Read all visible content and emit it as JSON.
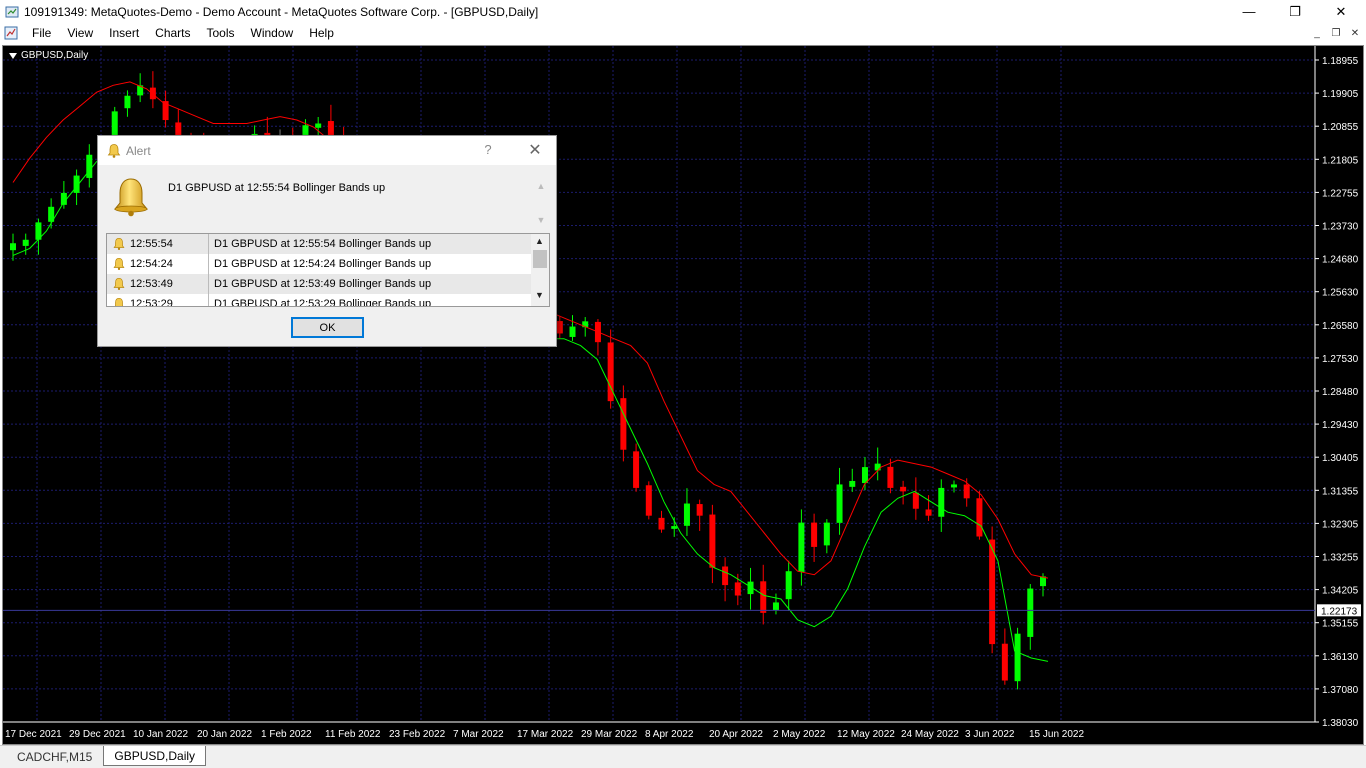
{
  "window": {
    "title": "109191349: MetaQuotes-Demo - Demo Account - MetaQuotes Software Corp. - [GBPUSD,Daily]",
    "minimize": "—",
    "maximize": "❐",
    "close": "✕"
  },
  "menu": {
    "items": [
      "File",
      "View",
      "Insert",
      "Charts",
      "Tools",
      "Window",
      "Help"
    ]
  },
  "mdi": {
    "minimize": "_",
    "restore": "❐",
    "close": "✕"
  },
  "chart": {
    "label": "GBPUSD,Daily",
    "current_price": "1.22173",
    "colors": {
      "bull": "#00ff00",
      "bear": "#ff0000",
      "neutral": "#808080",
      "upper_band": "#ff0000",
      "lower_band": "#00ff00",
      "grid": "#1c1c6e"
    }
  },
  "chart_data": {
    "type": "candlestick",
    "symbol": "GBPUSD",
    "timeframe": "Daily",
    "y_ticks": [
      "1.38030",
      "1.37080",
      "1.36130",
      "1.35155",
      "1.34205",
      "1.33255",
      "1.32305",
      "1.31355",
      "1.30405",
      "1.29430",
      "1.28480",
      "1.27530",
      "1.26580",
      "1.25630",
      "1.24680",
      "1.23730",
      "1.22755",
      "1.21805",
      "1.20855",
      "1.19905",
      "1.18955"
    ],
    "x_ticks": [
      "17 Dec 2021",
      "29 Dec 2021",
      "10 Jan 2022",
      "20 Jan 2022",
      "1 Feb 2022",
      "11 Feb 2022",
      "23 Feb 2022",
      "7 Mar 2022",
      "17 Mar 2022",
      "29 Mar 2022",
      "8 Apr 2022",
      "20 Apr 2022",
      "2 May 2022",
      "12 May 2022",
      "24 May 2022",
      "3 Jun 2022",
      "15 Jun 2022"
    ],
    "ylim": [
      1.18955,
      1.3803
    ],
    "current_price": 1.22173,
    "indicator": "Bollinger Bands",
    "close_path": [
      1.3275,
      1.3285,
      1.3335,
      1.338,
      1.342,
      1.347,
      1.353,
      1.3575,
      1.3655,
      1.37,
      1.373,
      1.369,
      1.363,
      1.3585,
      1.3555,
      1.353,
      1.354,
      1.351,
      1.356,
      1.359,
      1.3575,
      1.3575,
      1.3565,
      1.3615,
      1.362,
      1.3565,
      1.3535,
      1.344,
      1.338,
      1.338,
      1.3295,
      1.3175,
      1.312,
      1.3175,
      1.3115,
      1.312,
      1.3085,
      1.3065,
      1.304,
      1.3075,
      1.303,
      1.307,
      1.3045,
      1.3015,
      1.3035,
      1.305,
      1.299,
      1.282,
      1.268,
      1.257,
      1.249,
      1.245,
      1.246,
      1.2525,
      1.249,
      1.234,
      1.229,
      1.226,
      1.23,
      1.221,
      1.224,
      1.233,
      1.247,
      1.24,
      1.247,
      1.258,
      1.259,
      1.263,
      1.264,
      1.257,
      1.256,
      1.251,
      1.249,
      1.257,
      1.258,
      1.254,
      1.243,
      1.212,
      1.2015,
      1.215,
      1.228,
      1.2315
    ],
    "upper_band": [
      1.345,
      1.352,
      1.358,
      1.363,
      1.367,
      1.371,
      1.373,
      1.374,
      1.372,
      1.368,
      1.366,
      1.364,
      1.362,
      1.362,
      1.362,
      1.363,
      1.364,
      1.363,
      1.361,
      1.357,
      1.352,
      1.345,
      1.338,
      1.332,
      1.325,
      1.322,
      1.318,
      1.315,
      1.313,
      1.31,
      1.309,
      1.309,
      1.308,
      1.306,
      1.304,
      1.302,
      1.3,
      1.298,
      1.293,
      1.282,
      1.272,
      1.262,
      1.258,
      1.256,
      1.25,
      1.244,
      1.238,
      1.233,
      1.232,
      1.236,
      1.247,
      1.258,
      1.263,
      1.265,
      1.264,
      1.263,
      1.261,
      1.259,
      1.255,
      1.248,
      1.238,
      1.232,
      1.231
    ],
    "lower_band": [
      1.324,
      1.326,
      1.331,
      1.339,
      1.345,
      1.351,
      1.355,
      1.357,
      1.355,
      1.349,
      1.346,
      1.343,
      1.342,
      1.341,
      1.34,
      1.339,
      1.338,
      1.336,
      1.332,
      1.327,
      1.322,
      1.316,
      1.311,
      1.306,
      1.303,
      1.302,
      1.302,
      1.301,
      1.301,
      1.3,
      1.299,
      1.3,
      1.3,
      1.3,
      1.298,
      1.294,
      1.284,
      1.274,
      1.264,
      1.253,
      1.244,
      1.238,
      1.234,
      1.232,
      1.229,
      1.226,
      1.225,
      1.219,
      1.217,
      1.22,
      1.228,
      1.24,
      1.25,
      1.254,
      1.256,
      1.253,
      1.25,
      1.249,
      1.246,
      1.236,
      1.21,
      1.208,
      1.207
    ]
  },
  "alert": {
    "title": "Alert",
    "help": "?",
    "close": "✕",
    "message": "D1 GBPUSD at 12:55:54 Bollinger Bands up",
    "rows": [
      {
        "time": "12:55:54",
        "text": "D1 GBPUSD at 12:55:54 Bollinger Bands up"
      },
      {
        "time": "12:54:24",
        "text": "D1 GBPUSD at 12:54:24 Bollinger Bands up"
      },
      {
        "time": "12:53:49",
        "text": "D1 GBPUSD at 12:53:49 Bollinger Bands up"
      },
      {
        "time": "12:53:29",
        "text": "D1 GBPUSD at 12:53:29 Bollinger Bands up"
      }
    ],
    "ok_label": "OK"
  },
  "tabs": [
    {
      "label": "CADCHF,M15"
    },
    {
      "label": "GBPUSD,Daily"
    }
  ]
}
